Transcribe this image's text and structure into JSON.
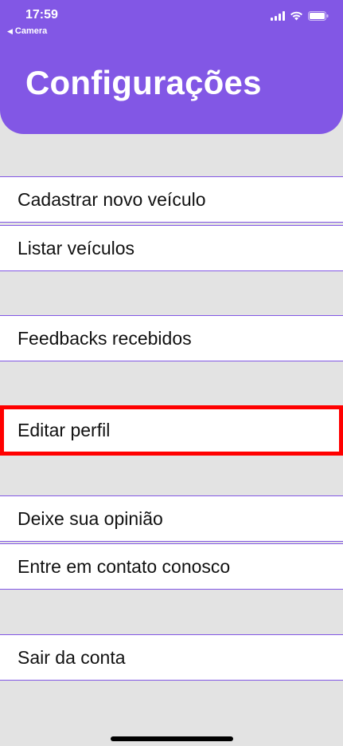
{
  "status_bar": {
    "time": "17:59",
    "back_app": "Camera",
    "back_arrow": "◀"
  },
  "header": {
    "title": "Configurações",
    "color": "#8257e5"
  },
  "menu": {
    "register_vehicle": "Cadastrar novo veículo",
    "list_vehicles": "Listar veículos",
    "feedbacks": "Feedbacks recebidos",
    "edit_profile": "Editar perfil",
    "leave_opinion": "Deixe sua opinião",
    "contact_us": "Entre em contato conosco",
    "logout": "Sair da conta"
  },
  "highlight_color": "#ff0000",
  "icons": [
    "cellular-signal-icon",
    "wifi-icon",
    "battery-icon",
    "back-arrow-icon"
  ]
}
